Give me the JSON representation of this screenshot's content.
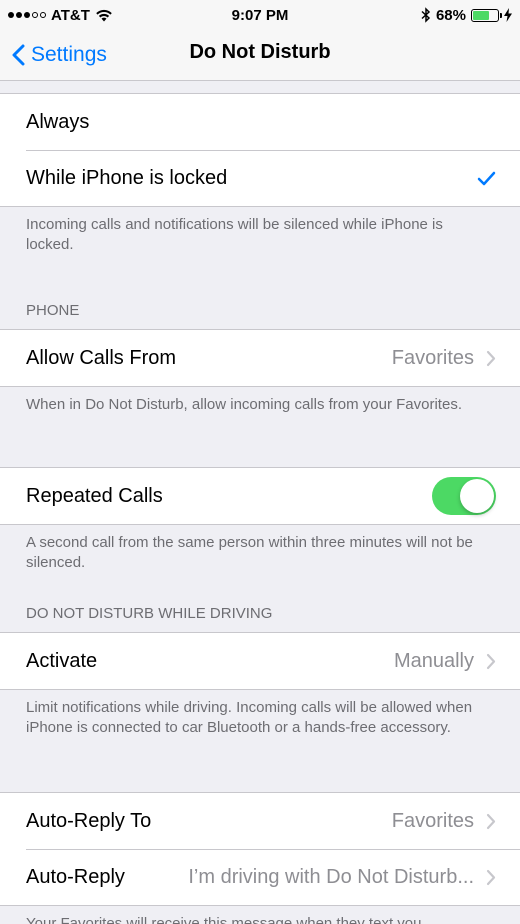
{
  "status_bar": {
    "carrier": "AT&T",
    "time": "9:07 PM",
    "battery_percent": "68%",
    "battery_level": 0.68
  },
  "nav": {
    "back_label": "Settings",
    "title": "Do Not Disturb"
  },
  "silence": {
    "options": [
      "Always",
      "While iPhone is locked"
    ],
    "selected": "While iPhone is locked",
    "footer": "Incoming calls and notifications will be silenced while iPhone is locked."
  },
  "phone": {
    "header": "PHONE",
    "allow_calls_label": "Allow Calls From",
    "allow_calls_value": "Favorites",
    "allow_calls_footer": "When in Do Not Disturb, allow incoming calls from your Favorites.",
    "repeated_calls_label": "Repeated Calls",
    "repeated_calls_on": true,
    "repeated_calls_footer": "A second call from the same person within three minutes will not be silenced."
  },
  "driving": {
    "header": "DO NOT DISTURB WHILE DRIVING",
    "activate_label": "Activate",
    "activate_value": "Manually",
    "activate_footer": "Limit notifications while driving. Incoming calls will be allowed when iPhone is connected to car Bluetooth or a hands-free accessory.",
    "auto_reply_to_label": "Auto-Reply To",
    "auto_reply_to_value": "Favorites",
    "auto_reply_label": "Auto-Reply",
    "auto_reply_value": "I’m driving with Do Not Disturb...",
    "auto_reply_footer": "Your Favorites will receive this message when they text you,"
  },
  "colors": {
    "accent": "#007aff",
    "toggle_on": "#4cd964",
    "background": "#efeff4"
  }
}
